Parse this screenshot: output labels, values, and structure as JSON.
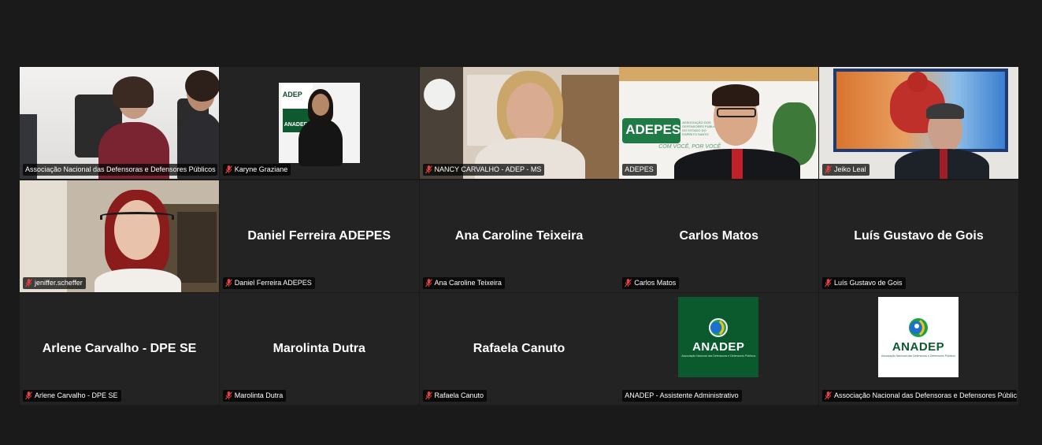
{
  "tiles": [
    {
      "name": "Associação Nacional das Defensoras e Defensores Públicos ...",
      "muted": false,
      "type": "video"
    },
    {
      "name": "Karyne Graziane",
      "muted": true,
      "type": "video"
    },
    {
      "name": "NANCY CARVALHO - ADEP - MS",
      "muted": true,
      "type": "video"
    },
    {
      "name": "ADEPES",
      "muted": false,
      "type": "video",
      "active": true
    },
    {
      "name": "Jeiko Leal",
      "muted": true,
      "type": "video"
    },
    {
      "name": "jeniffer.scheffer",
      "muted": true,
      "type": "video"
    },
    {
      "name": "Daniel Ferreira ADEPES",
      "muted": true,
      "type": "name",
      "display": "Daniel Ferreira ADEPES"
    },
    {
      "name": "Ana Caroline Teixeira",
      "muted": true,
      "type": "name",
      "display": "Ana Caroline Teixeira"
    },
    {
      "name": "Carlos Matos",
      "muted": true,
      "type": "name",
      "display": "Carlos Matos"
    },
    {
      "name": "Luís Gustavo de Gois",
      "muted": true,
      "type": "name",
      "display": "Luís Gustavo de Gois"
    },
    {
      "name": "Arlene Carvalho - DPE SE",
      "muted": true,
      "type": "name",
      "display": "Arlene Carvalho - DPE SE"
    },
    {
      "name": "Marolinta Dutra",
      "muted": true,
      "type": "name",
      "display": "Marolinta Dutra"
    },
    {
      "name": "Rafaela Canuto",
      "muted": true,
      "type": "name",
      "display": "Rafaela Canuto"
    },
    {
      "name": "ANADEP - Assistente Administrativo",
      "muted": false,
      "type": "logo-green"
    },
    {
      "name": "Associação Nacional das Defensoras e Defensores Públic...",
      "muted": true,
      "type": "logo-white"
    }
  ],
  "backdrop_logo": "ADEP",
  "backdrop_logo2": "ANADEP",
  "adepes_logo": "ADEPES",
  "adepes_slogan": "COM VOCÊ, POR VOCÊ",
  "adepes_small": "ASSOCIAÇÃO DOS DEFENSORES PÚBLICOS DO ESTADO DO ESPÍRITO SANTO",
  "anadep_logo": "ANADEP",
  "anadep_sub": "Associação Nacional das Defensoras e Defensores Públicos",
  "colors": {
    "mute": "#e0443e",
    "active_border": "#c8d94a",
    "anadep_green": "#0b5a2e",
    "background": "#1a1a1a",
    "tile": "#232323"
  }
}
